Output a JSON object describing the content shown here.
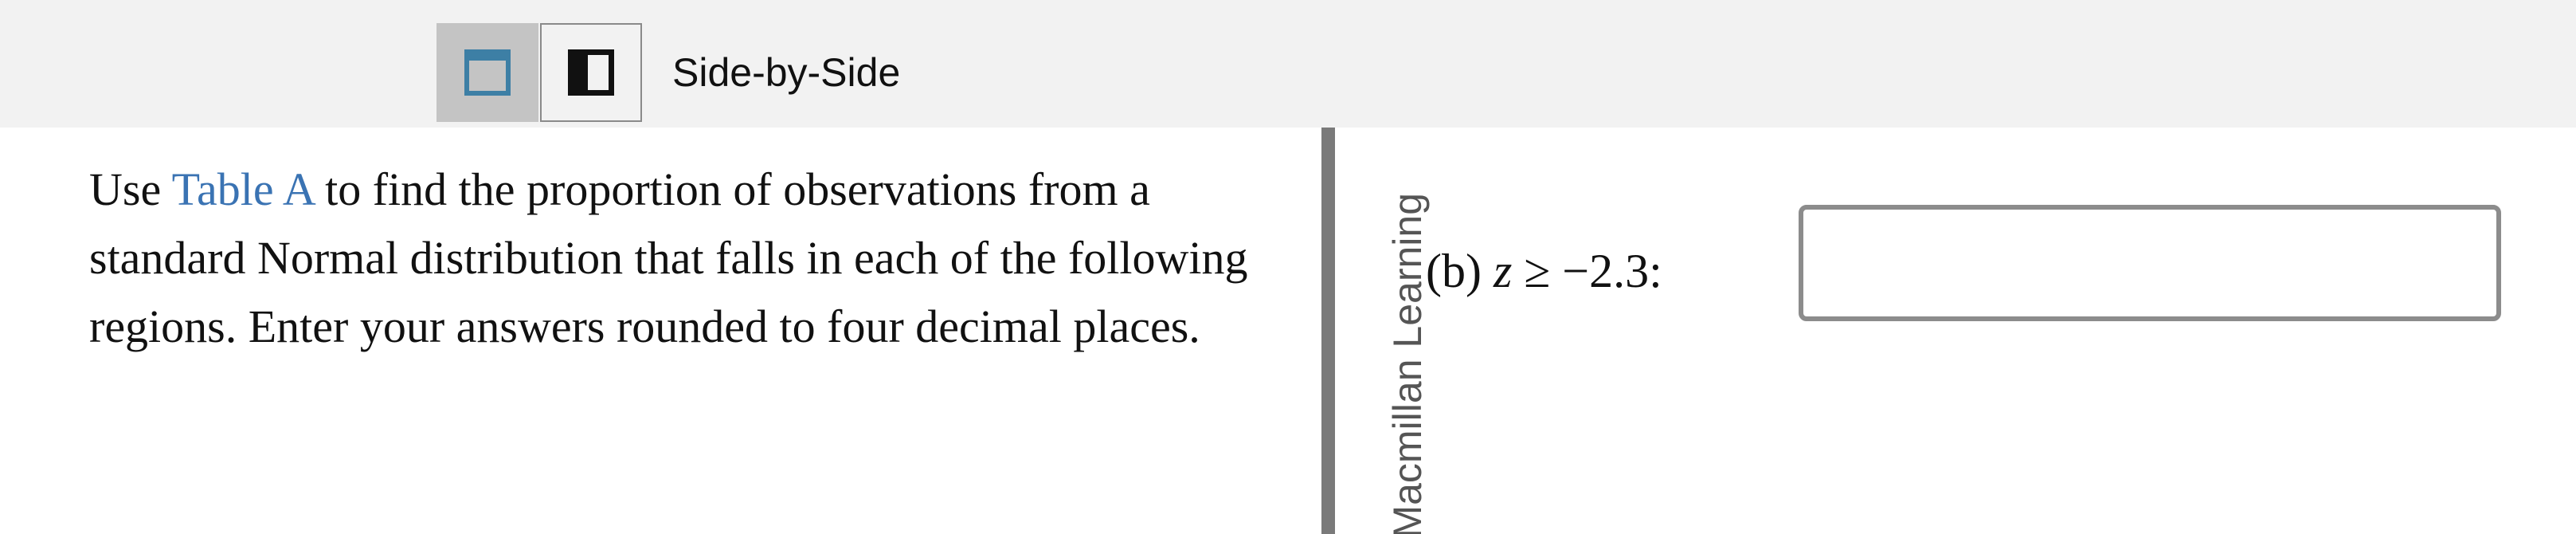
{
  "toolbar": {
    "view_label": "Side-by-Side",
    "buttons": [
      {
        "icon": "single-pane-layout-icon",
        "state": "active"
      },
      {
        "icon": "side-by-side-layout-icon",
        "state": "inactive"
      }
    ],
    "colors": {
      "background": "#f2f2f2",
      "active_button": "#c4c4c4",
      "active_icon": "#3d7fa5"
    }
  },
  "prompt": {
    "before_link": "Use ",
    "link_text": "Table A",
    "after_link": " to find the proportion of observations from a standard Normal distribution that falls in each of the following regions. Enter your answers rounded to four decimal places.",
    "link_color": "#3a73b3"
  },
  "sidebar_label": "Macmillan Learning",
  "question": {
    "part": "(b)",
    "variable": "z",
    "relation": "≥ −2.3:"
  },
  "answer": {
    "value": "",
    "placeholder": ""
  }
}
